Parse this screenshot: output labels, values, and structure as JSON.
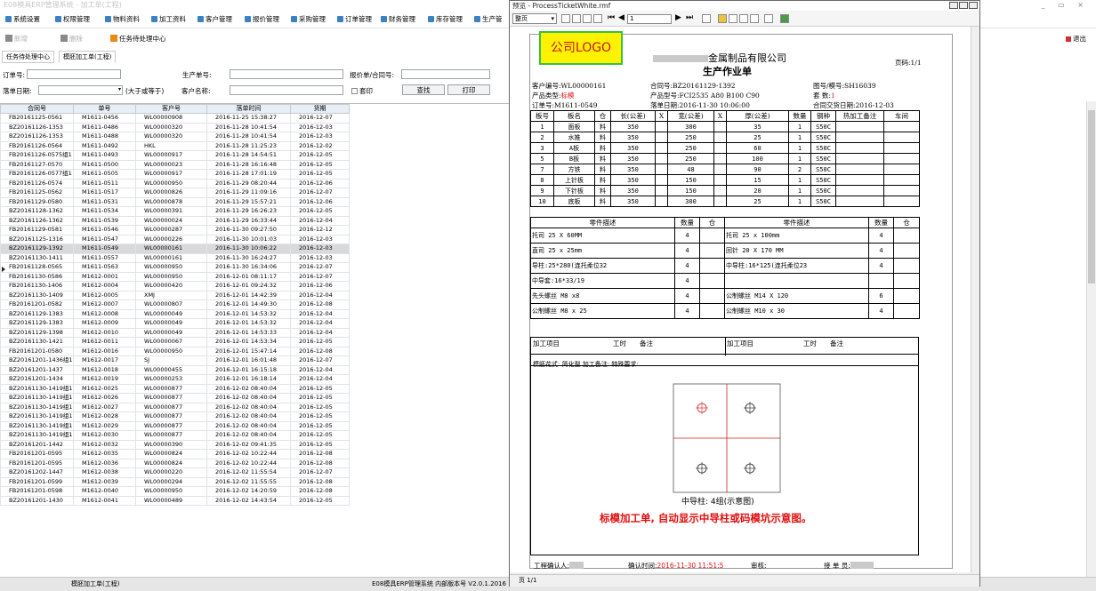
{
  "app": {
    "title": "E08模具ERP管理系统 - 加工单(工程)",
    "menu": [
      "系统设置",
      "权限管理",
      "物料资料",
      "加工资料",
      "客户管理",
      "报价管理",
      "采购管理",
      "订单管理",
      "财务管理",
      "库存管理",
      "生产管"
    ],
    "toolbar": {
      "btn1": "新增",
      "btn2": "删除",
      "btn3": "任务待处理中心",
      "exit": "退出"
    },
    "tabs": [
      "任务待处理中心",
      "模胚加工单(工程)"
    ],
    "filters": {
      "order_no_label": "订单号:",
      "production_no_label": "生产单号:",
      "quote_label": "报价单/合同号:",
      "date_label": "落单日期:",
      "date_suffix": "(大于或等于)",
      "customer_label": "客户名称:",
      "print_label": "套印",
      "query_btn": "查找",
      "print_btn": "打印"
    },
    "grid": {
      "columns": [
        "合同号",
        "单号",
        "客户号",
        "落单时间",
        "货期"
      ],
      "selected_index": 14,
      "rows": [
        [
          "FB20161125-0561",
          "M1611-0456",
          "WL00000908",
          "2016-11-25 15:38:27",
          "2016-12-07"
        ],
        [
          "BZ20161126-1353",
          "M1611-0486",
          "WL00000320",
          "2016-11-28 10:41:54",
          "2016-12-03"
        ],
        [
          "BZ20161126-1353",
          "M1611-0488",
          "WL00000320",
          "2016-11-28 10:41:54",
          "2016-12-03"
        ],
        [
          "FB20161126-0564",
          "M1611-0492",
          "HKL",
          "2016-11-28 11:25:23",
          "2016-12-02"
        ],
        [
          "FB20161126-0575组1",
          "M1611-0493",
          "WL00000917",
          "2016-11-28 14:54:51",
          "2016-12-05"
        ],
        [
          "FB20161127-0570",
          "M1611-0500",
          "WL00000023",
          "2016-11-28 16:16:48",
          "2016-12-05"
        ],
        [
          "FB20161126-0577组1",
          "M1611-0505",
          "WL00000917",
          "2016-11-28 17:01:19",
          "2016-12-05"
        ],
        [
          "FB20161126-0574",
          "M1611-0511",
          "WL00000950",
          "2016-11-29 08:20:44",
          "2016-12-06"
        ],
        [
          "FB20161125-0562",
          "M1611-0517",
          "WL00000826",
          "2016-11-29 11:09:16",
          "2016-12-07"
        ],
        [
          "FB20161129-0580",
          "M1611-0531",
          "WL00000878",
          "2016-11-29 15:57:21",
          "2016-12-06"
        ],
        [
          "BZ20161128-1362",
          "M1611-0534",
          "WL00000391",
          "2016-11-29 16:26:23",
          "2016-12-05"
        ],
        [
          "BZ20161126-1362",
          "M1611-0539",
          "WL00000024",
          "2016-11-29 16:33:44",
          "2016-12-04"
        ],
        [
          "FB20161129-0581",
          "M1611-0546",
          "WL00000287",
          "2016-11-30 09:27:50",
          "2016-12-12"
        ],
        [
          "BZ20161125-1316",
          "M1611-0547",
          "WL00000226",
          "2016-11-30 10:01:03",
          "2016-12-03"
        ],
        [
          "BZ20161129-1392",
          "M1611-0549",
          "WL00000161",
          "2016-11-30 10:06:22",
          "2016-12-03"
        ],
        [
          "BZ20161130-1411",
          "M1611-0557",
          "WL00000161",
          "2016-11-30 16:24:27",
          "2016-12-03"
        ],
        [
          "FB20161128-0565",
          "M1611-0563",
          "WL00000950",
          "2016-11-30 16:34:06",
          "2016-12-07"
        ],
        [
          "FB20161130-0586",
          "M1612-0001",
          "WL00000950",
          "2016-12-01 08:11:17",
          "2016-12-07"
        ],
        [
          "FB20161130-1406",
          "M1612-0004",
          "WL00000420",
          "2016-12-01 09:24:32",
          "2016-12-06"
        ],
        [
          "BZ20161130-1409",
          "M1612-0005",
          "XMJ",
          "2016-12-01 14:42:39",
          "2016-12-04"
        ],
        [
          "FB20161201-0582",
          "M1612-0007",
          "WL00000807",
          "2016-12-01 14:49:30",
          "2016-12-08"
        ],
        [
          "BZ20161129-1383",
          "M1612-0008",
          "WL00000049",
          "2016-12-01 14:53:32",
          "2016-12-04"
        ],
        [
          "BZ20161129-1383",
          "M1612-0009",
          "WL00000049",
          "2016-12-01 14:53:32",
          "2016-12-04"
        ],
        [
          "BZ20161129-1398",
          "M1612-0010",
          "WL00000049",
          "2016-12-01 14:53:33",
          "2016-12-04"
        ],
        [
          "BZ20161130-1421",
          "M1612-0011",
          "WL00000067",
          "2016-12-01 14:53:34",
          "2016-12-05"
        ],
        [
          "FB20161201-0580",
          "M1612-0016",
          "WL00000950",
          "2016-12-01 15:47:14",
          "2016-12-08"
        ],
        [
          "BZ20161201-1436组1",
          "M1612-0017",
          "SJ",
          "2016-12-01 16:01:48",
          "2016-12-07"
        ],
        [
          "BZ20161201-1437",
          "M1612-0018",
          "WL00000455",
          "2016-12-01 16:15:18",
          "2016-12-04"
        ],
        [
          "BZ20161201-1434",
          "M1612-0019",
          "WL00000253",
          "2016-12-01 16:18:14",
          "2016-12-04"
        ],
        [
          "BZ20161130-1419组1",
          "M1612-0025",
          "WL00000877",
          "2016-12-02 08:40:04",
          "2016-12-05"
        ],
        [
          "BZ20161130-1419组1",
          "M1612-0026",
          "WL00000877",
          "2016-12-02 08:40:04",
          "2016-12-05"
        ],
        [
          "BZ20161130-1419组1",
          "M1612-0027",
          "WL00000877",
          "2016-12-02 08:40:04",
          "2016-12-05"
        ],
        [
          "BZ20161130-1419组1",
          "M1612-0028",
          "WL00000877",
          "2016-12-02 08:40:04",
          "2016-12-05"
        ],
        [
          "BZ20161130-1419组1",
          "M1612-0029",
          "WL00000877",
          "2016-12-02 08:40:04",
          "2016-12-05"
        ],
        [
          "BZ20161130-1419组1",
          "M1612-0030",
          "WL00000877",
          "2016-12-02 08:40:04",
          "2016-12-05"
        ],
        [
          "BZ20161201-1442",
          "M1612-0032",
          "WL00000390",
          "2016-12-02 09:41:35",
          "2016-12-05"
        ],
        [
          "FB20161201-0595",
          "M1612-0035",
          "WL00000824",
          "2016-12-02 10:22:44",
          "2016-12-08"
        ],
        [
          "FB20161201-0595",
          "M1612-0036",
          "WL00000824",
          "2016-12-02 10:22:44",
          "2016-12-08"
        ],
        [
          "BZ20161202-1447",
          "M1612-0038",
          "WL00000220",
          "2016-12-02 11:55:54",
          "2016-12-07"
        ],
        [
          "FB20161201-0599",
          "M1612-0039",
          "WL00000294",
          "2016-12-02 11:55:55",
          "2016-12-08"
        ],
        [
          "FB20161201-0598",
          "M1612-0040",
          "WL00000950",
          "2016-12-02 14:20:59",
          "2016-12-08"
        ],
        [
          "BZ20161201-1430",
          "M1612-0041",
          "WL00000489",
          "2016-12-02 14:43:54",
          "2016-12-05"
        ]
      ]
    },
    "status": {
      "left": "模胚加工单(工程)",
      "right": "E08模具ERP管理系统 内部版本号 V2.0.1.2016"
    }
  },
  "preview": {
    "title": "预览 - ProcessTicketWhite.rmf",
    "zoom": "整页",
    "page_input": "1",
    "status": "页 1/1",
    "ticket": {
      "logo": "公司LOGO",
      "company_suffix": "金属制品有限公司",
      "title": "生产作业单",
      "page_label": "页码:1/1",
      "customer_no": "客户编号:WL00000161",
      "contract_no": "合同号:BZ20161129-1392",
      "drawing_no": "图号/模号:SH16039",
      "type_label": "产品类型:",
      "type_value": "标模",
      "model": "产品型号:FCI2535 A80 B100 C90",
      "sets_label": "套  数:",
      "sets_value": "1",
      "order_no": "订单号:M1611-0549",
      "order_date": "落单日期:2016-11-30 10:06:00",
      "delivery": "合同交货日期:2016-12-03",
      "plate_headers": [
        "板号",
        "板名",
        "仓",
        "长(公差)",
        "X",
        "宽(公差)",
        "X",
        "厚(公差)",
        "数量",
        "钢种",
        "热加工备注",
        "车间"
      ],
      "plates": [
        [
          "1",
          "面板",
          "料",
          "350",
          "300",
          "35",
          "1",
          "S50C"
        ],
        [
          "2",
          "水推",
          "料",
          "350",
          "250",
          "25",
          "1",
          "S50C"
        ],
        [
          "3",
          "A板",
          "料",
          "350",
          "250",
          "60",
          "1",
          "S50C"
        ],
        [
          "5",
          "B板",
          "料",
          "350",
          "250",
          "100",
          "1",
          "S50C"
        ],
        [
          "7",
          "方铁",
          "料",
          "350",
          "48",
          "90",
          "2",
          "S50C"
        ],
        [
          "8",
          "上针板",
          "料",
          "350",
          "150",
          "15",
          "1",
          "S50C"
        ],
        [
          "9",
          "下针板",
          "料",
          "350",
          "150",
          "20",
          "1",
          "S50C"
        ],
        [
          "10",
          "底板",
          "料",
          "350",
          "300",
          "25",
          "1",
          "S50C"
        ]
      ],
      "parts_headers": [
        "零件描述",
        "数量",
        "仓",
        "零件描述",
        "数量",
        "仓"
      ],
      "parts": [
        [
          "托司 25 X 60MM",
          "4",
          "托司 25 x 100mm",
          "4"
        ],
        [
          "直司 25 x 25mm",
          "4",
          "回针 20 X 170 MM",
          "4"
        ],
        [
          "导柱:25*280(连托柔位32",
          "4",
          "中导柱:16*125(连托柔位23",
          "4"
        ],
        [
          "中导套:16*33/19",
          "4",
          "",
          ""
        ],
        [
          "先头螺丝 M8 x8",
          "4",
          "公制螺丝 M14 X 120",
          "6"
        ],
        [
          "公制螺丝 M8 x 25",
          "4",
          "公制螺丝 M10 x 30",
          "4"
        ]
      ],
      "proc_headers": [
        "加工项目",
        "工时",
        "备注",
        "加工项目",
        "工时",
        "备注"
      ],
      "remark": "模胚花式: 简化型  加工备注:  特殊要求:",
      "diagram_caption": "中导柱: 4组(示意图)",
      "annotation": "标模加工单, 自动显示中导柱或码模坑示意图。",
      "footer_engineer": "工程确认人:",
      "footer_time_label": "确认时间:",
      "footer_time": "2016-11-30 11:51:5",
      "footer_audit": "审核:",
      "footer_receiver": "接 单 员:"
    }
  }
}
